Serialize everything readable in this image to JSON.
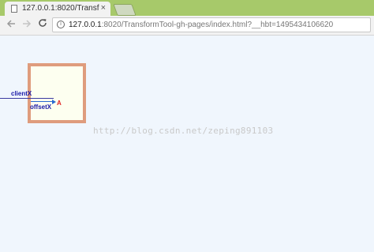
{
  "browser": {
    "tab": {
      "title": "127.0.0.1:8020/Transfo",
      "close_glyph": "×"
    },
    "toolbar": {
      "back_icon": "arrow-left-icon",
      "forward_icon": "arrow-right-icon",
      "reload_icon": "reload-icon"
    },
    "address_bar": {
      "host": "127.0.0.1",
      "rest": ":8020/TransformTool-gh-pages/index.html?__hbt=1495434106620"
    }
  },
  "page": {
    "labels": {
      "clientx": "clientX",
      "offsetx": "offsetX",
      "point": "A"
    },
    "colors": {
      "box_border": "#df9c7d",
      "box_fill": "#fdfff0",
      "background": "#f0f6fd",
      "label_text": "#1a1aa8",
      "point_text": "#e02020"
    },
    "watermark": "http://blog.csdn.net/zeping891103"
  }
}
